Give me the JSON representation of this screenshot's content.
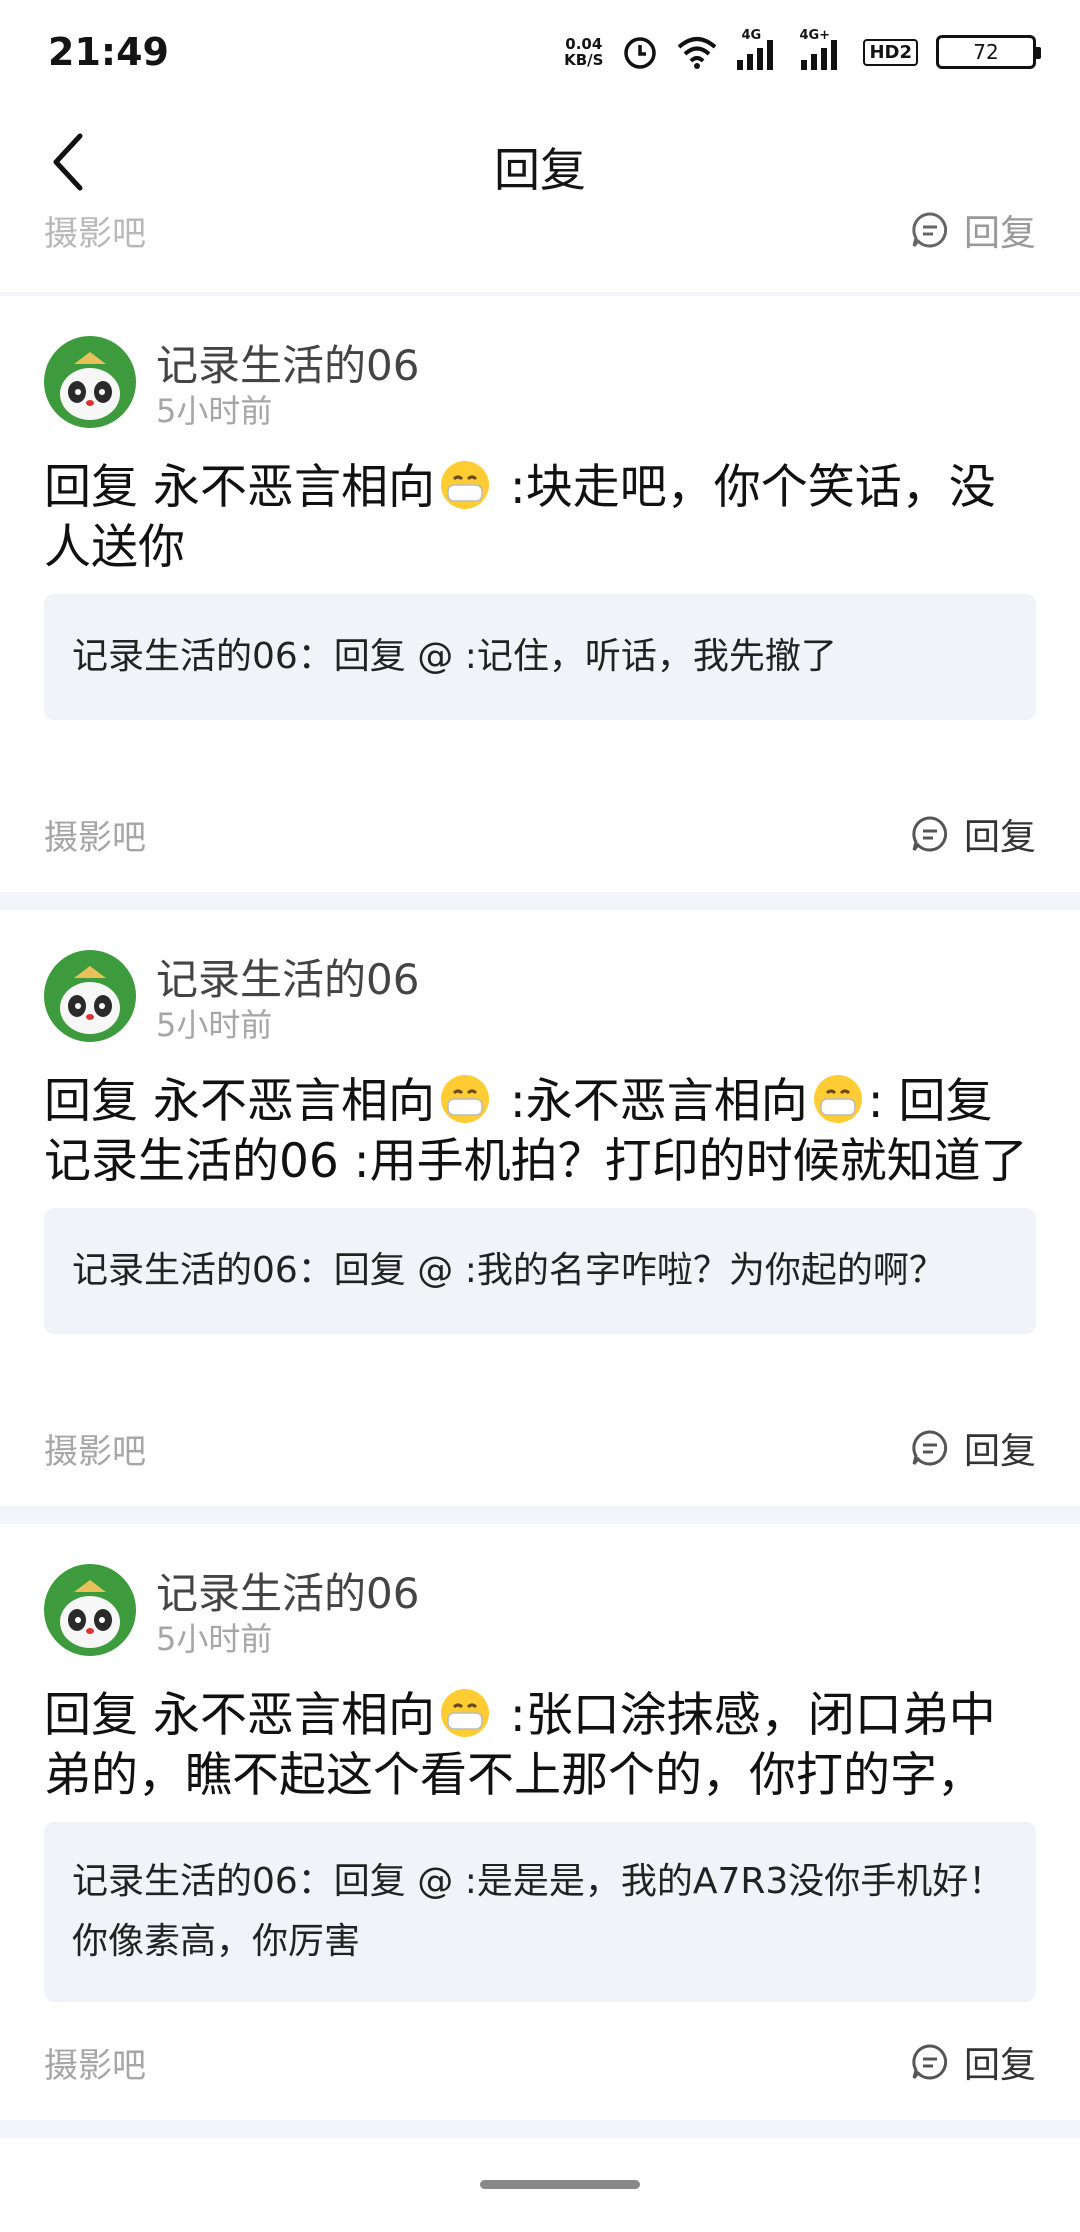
{
  "status_bar": {
    "time": "21:49",
    "net_speed_value": "0.04",
    "net_speed_unit": "KB/S",
    "battery": "72",
    "signal_1_label": "4G",
    "signal_2_label": "4G+",
    "hd_label": "HD2"
  },
  "nav": {
    "title": "回复",
    "back_icon": "chevron-left-icon"
  },
  "top_partial": {
    "forum": "摄影吧",
    "reply_label": "回复"
  },
  "cards": [
    {
      "username": "记录生活的06",
      "time_ago": "5小时前",
      "content_prefix": "回复 永不恶言相向",
      "content_suffix": " :块走吧，你个笑话，没人送你",
      "quote": "记录生活的06：回复 @ :记住，听话，我先撤了",
      "forum": "摄影吧",
      "reply_label": "回复"
    },
    {
      "username": "记录生活的06",
      "time_ago": "5小时前",
      "content_prefix": "回复 永不恶言相向",
      "content_middle": " :永不恶言相向",
      "content_suffix": ": 回复 记录生活的06 :用手机拍？打印的时候就知道了",
      "quote": "记录生活的06：回复 @ :我的名字咋啦？为你起的啊？",
      "forum": "摄影吧",
      "reply_label": "回复"
    },
    {
      "username": "记录生活的06",
      "time_ago": "5小时前",
      "content_prefix": "回复 永不恶言相向",
      "content_suffix": " :张口涂抹感，闭口弟中弟的，瞧不起这个看不上那个的，你打的字，",
      "quote": "记录生活的06：回复 @ :是是是，我的A7R3没你手机好！你像素高，你厉害",
      "forum": "摄影吧",
      "reply_label": "回复"
    }
  ],
  "colors": {
    "background": "#f3f5fa",
    "card": "#ffffff",
    "quote_bg": "#f2f3f9",
    "meta_text": "#a6a6a6"
  }
}
